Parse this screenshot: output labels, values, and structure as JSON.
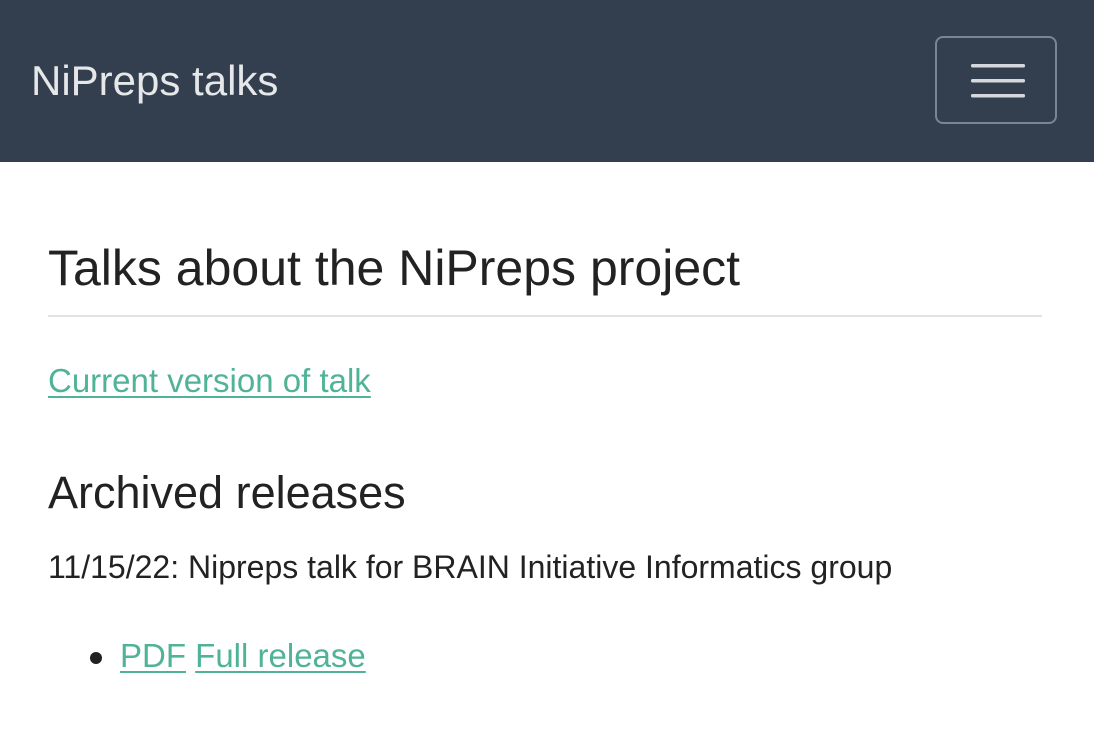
{
  "navbar": {
    "brand": "NiPreps talks",
    "toggle_icon": "hamburger-menu-icon",
    "background_color": "#333f4f"
  },
  "main": {
    "title": "Talks about the NiPreps project",
    "current_link": "Current version of talk",
    "archived_heading": "Archived releases",
    "releases": [
      {
        "description": "11/15/22: Nipreps talk for BRAIN Initiative Informatics group",
        "pdf_label": "PDF",
        "full_label": "Full release"
      }
    ]
  },
  "colors": {
    "link": "#50b397",
    "text": "#222222"
  }
}
